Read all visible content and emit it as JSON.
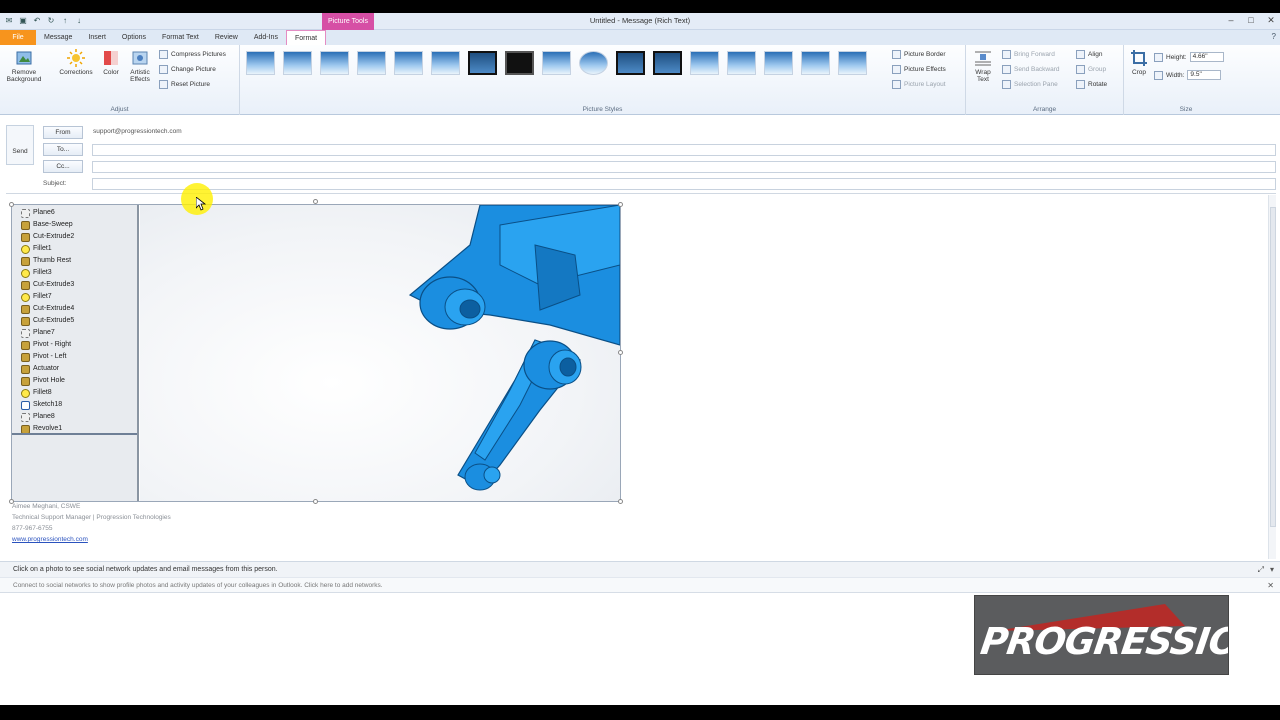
{
  "window": {
    "title": "Untitled - Message (Rich Text)",
    "context_tab_group": "Picture Tools"
  },
  "tabs": [
    "File",
    "Message",
    "Insert",
    "Options",
    "Format Text",
    "Review",
    "Add-Ins",
    "Format"
  ],
  "ribbon": {
    "adjust": {
      "label": "Adjust",
      "remove_background": "Remove Background",
      "corrections": "Corrections",
      "color": "Color",
      "artistic_effects": "Artistic Effects",
      "compress": "Compress Pictures",
      "change": "Change Picture",
      "reset": "Reset Picture"
    },
    "picture_styles": {
      "label": "Picture Styles",
      "border": "Picture Border",
      "effects": "Picture Effects",
      "layout": "Picture Layout"
    },
    "arrange": {
      "label": "Arrange",
      "wrap_text": "Wrap Text",
      "bring_forward": "Bring Forward",
      "send_backward": "Send Backward",
      "selection_pane": "Selection Pane",
      "align": "Align",
      "group": "Group",
      "rotate": "Rotate"
    },
    "size": {
      "label": "Size",
      "crop": "Crop",
      "height_label": "Height:",
      "height_value": "4.66\"",
      "width_label": "Width:",
      "width_value": "9.5\""
    }
  },
  "header": {
    "send": "Send",
    "from_btn": "From",
    "from_value": "support@progressiontech.com",
    "to_btn": "To...",
    "cc_btn": "Cc...",
    "subject_label": "Subject:"
  },
  "feature_tree": [
    {
      "label": "Plane6",
      "icon": "plane"
    },
    {
      "label": "Base-Sweep",
      "icon": "feature"
    },
    {
      "label": "Cut-Extrude2",
      "icon": "feature"
    },
    {
      "label": "Fillet1",
      "icon": "fillet"
    },
    {
      "label": "Thumb Rest",
      "icon": "feature"
    },
    {
      "label": "Fillet3",
      "icon": "fillet"
    },
    {
      "label": "Cut-Extrude3",
      "icon": "feature"
    },
    {
      "label": "Fillet7",
      "icon": "fillet"
    },
    {
      "label": "Cut-Extrude4",
      "icon": "feature"
    },
    {
      "label": "Cut-Extrude5",
      "icon": "feature"
    },
    {
      "label": "Plane7",
      "icon": "plane"
    },
    {
      "label": "Pivot - Right",
      "icon": "feature"
    },
    {
      "label": "Pivot - Left",
      "icon": "feature"
    },
    {
      "label": "Actuator",
      "icon": "feature"
    },
    {
      "label": "Pivot Hole",
      "icon": "feature"
    },
    {
      "label": "Fillet8",
      "icon": "fillet"
    },
    {
      "label": "Sketch18",
      "icon": "sketch"
    },
    {
      "label": "Plane8",
      "icon": "plane"
    },
    {
      "label": "Revolve1",
      "icon": "feature"
    }
  ],
  "signature": {
    "name": "Aimee Meghani, CSWE",
    "title": "Technical Support Manager | Progression Technologies",
    "phone": "877-967-6755",
    "website": "www.progressiontech.com"
  },
  "social": {
    "prompt": "Click on a photo to see social network updates and email messages from this person.",
    "connect": "Connect to social networks to show profile photos and activity updates of your colleagues in Outlook. Click here to add networks."
  },
  "logo": {
    "text": "PROGRESSION"
  },
  "colors": {
    "part_blue": "#1a8fe0",
    "file_tab": "#f7941d",
    "tools_pink": "#d64fa5"
  }
}
